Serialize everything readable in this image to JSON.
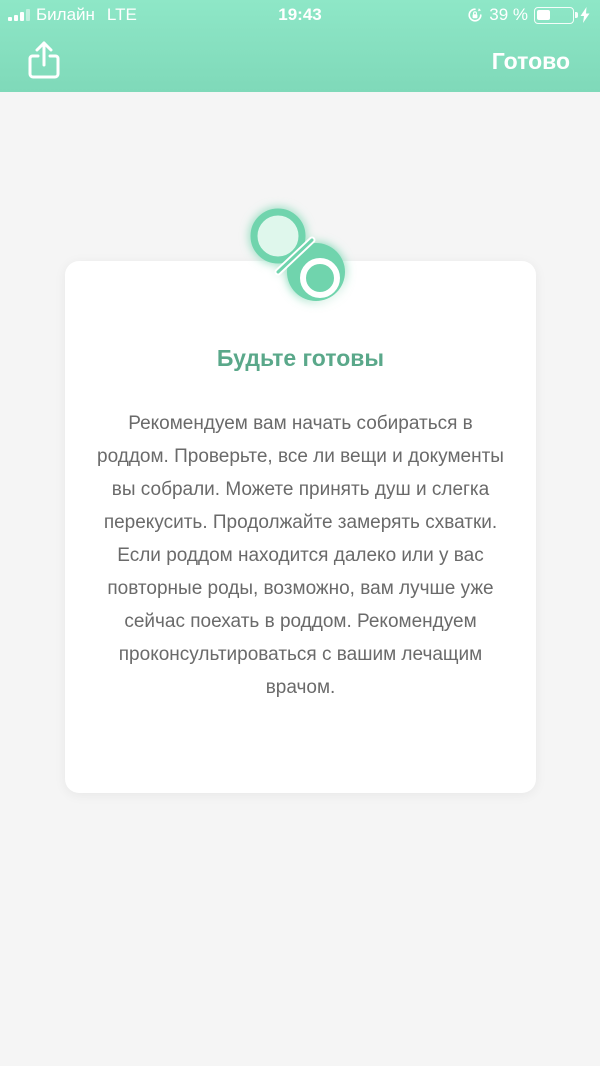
{
  "status_bar": {
    "carrier": "Билайн",
    "network": "LTE",
    "time": "19:43",
    "battery_text": "39 %",
    "battery_level": 0.39
  },
  "header": {
    "done_label": "Готово",
    "share_icon": "share-icon",
    "gradient_top": "#8ee7c7",
    "gradient_bottom": "#7fd9b9"
  },
  "card": {
    "icon": "pacifier-icon",
    "title": "Будьте готовы",
    "body": "Рекомендуем вам начать собираться в роддом. Проверьте, все ли вещи и документы вы собрали. Можете принять душ и слегка перекусить. Продолжайте замерять схватки. Если роддом находится далеко или у вас повторные роды, возможно, вам лучше уже сейчас поехать в роддом. Рекомендуем проконсультироваться с вашим лечащим врачом.",
    "title_color": "#5aa88a",
    "text_color": "#6a6a6a"
  },
  "colors": {
    "background": "#f5f5f5",
    "accent": "#6fd4ad"
  }
}
